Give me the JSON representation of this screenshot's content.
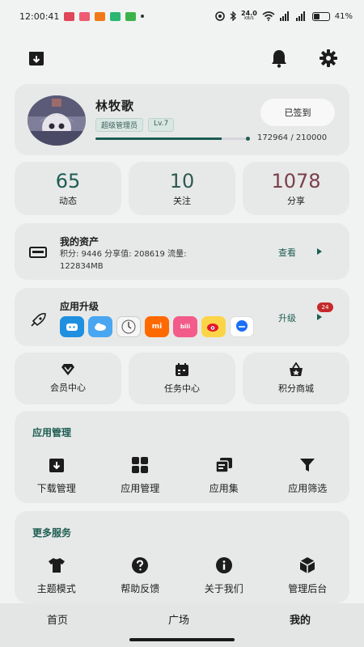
{
  "status_bar": {
    "time": "12:00:41",
    "net_speed_value": "24.0",
    "net_speed_unit": "KB/S",
    "battery": "41%",
    "battery_level": 0.41
  },
  "header": {
    "icons": [
      "download-box-icon",
      "bell-icon",
      "gear-icon"
    ]
  },
  "profile": {
    "name": "林牧歌",
    "role_badge": "超级管理员",
    "level_badge": "Lv.7",
    "checkin_button": "已签到",
    "exp_text": "172964 / 210000",
    "exp_fraction": 0.823
  },
  "stats": [
    {
      "value": "65",
      "label": "动态",
      "color": "#1d5d52"
    },
    {
      "value": "10",
      "label": "关注",
      "color": "#2f5a52"
    },
    {
      "value": "1078",
      "label": "分享",
      "color": "#7a3f4c"
    }
  ],
  "assets": {
    "title": "我的资产",
    "line1": "积分: 9446  分享值: 208619  流量:",
    "line2": "122834MB",
    "action": "查看"
  },
  "upgrade": {
    "title": "应用升级",
    "action": "升级",
    "badge_count": "24",
    "app_icons": [
      "bilibili-like-tv-icon",
      "weather-icon",
      "clock-icon",
      "xiaomi-icon",
      "bilibili-icon",
      "weibo-icon",
      "messaging-icon"
    ]
  },
  "quick_actions": [
    {
      "label": "会员中心",
      "icon": "diamond-icon"
    },
    {
      "label": "任务中心",
      "icon": "calendar-icon"
    },
    {
      "label": "积分商城",
      "icon": "shopping-basket-icon"
    }
  ],
  "app_management": {
    "title": "应用管理",
    "items": [
      {
        "label": "下载管理",
        "icon": "download-box-icon"
      },
      {
        "label": "应用管理",
        "icon": "grid-apps-icon"
      },
      {
        "label": "应用集",
        "icon": "collection-icon"
      },
      {
        "label": "应用筛选",
        "icon": "filter-icon"
      }
    ]
  },
  "more_services": {
    "title": "更多服务",
    "items": [
      {
        "label": "主题模式",
        "icon": "tshirt-icon"
      },
      {
        "label": "帮助反馈",
        "icon": "help-icon"
      },
      {
        "label": "关于我们",
        "icon": "info-icon"
      },
      {
        "label": "管理后台",
        "icon": "cube-icon"
      }
    ]
  },
  "bottom_nav": [
    {
      "label": "首页",
      "active": false
    },
    {
      "label": "广场",
      "active": false
    },
    {
      "label": "我的",
      "active": true
    }
  ],
  "colors": {
    "accent": "#1d5d52",
    "card": "#e7e9e8",
    "background": "#f1f3f2",
    "badge_red": "#c52a2a"
  }
}
